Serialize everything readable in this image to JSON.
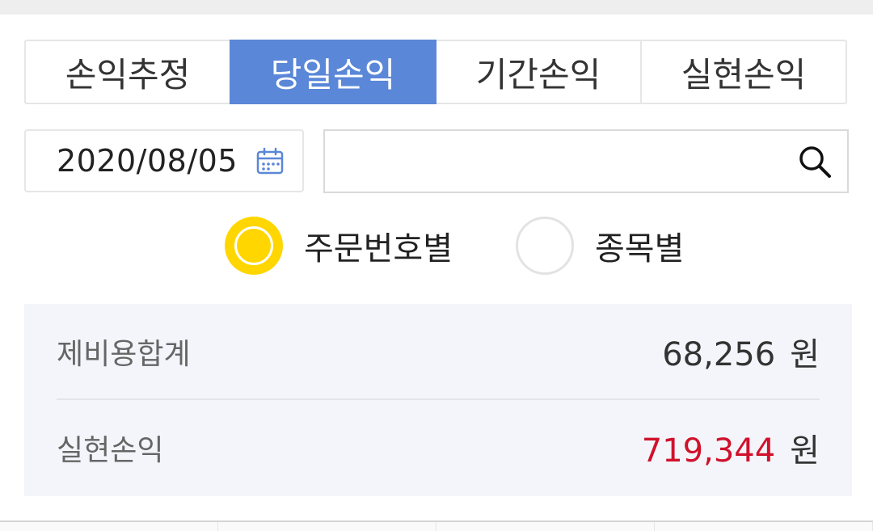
{
  "tabs": [
    {
      "label": "손익추정",
      "active": false
    },
    {
      "label": "당일손익",
      "active": true
    },
    {
      "label": "기간손익",
      "active": false
    },
    {
      "label": "실현손익",
      "active": false
    }
  ],
  "date_picker": {
    "value": "2020/08/05",
    "icon": "calendar-icon"
  },
  "search": {
    "value": "",
    "placeholder": "",
    "icon": "search-icon"
  },
  "radio": {
    "options": [
      {
        "label": "주문번호별",
        "selected": true
      },
      {
        "label": "종목별",
        "selected": false
      }
    ]
  },
  "summary": {
    "rows": [
      {
        "label": "제비용합계",
        "value": "68,256",
        "unit": "원",
        "color": "#333333"
      },
      {
        "label": "실현손익",
        "value": "719,344",
        "unit": "원",
        "color": "#d0112b"
      }
    ]
  },
  "colors": {
    "accent": "#5a87d7",
    "radio_selected": "#ffd600",
    "profit_red": "#d0112b",
    "panel_bg": "#f3f5fa"
  }
}
